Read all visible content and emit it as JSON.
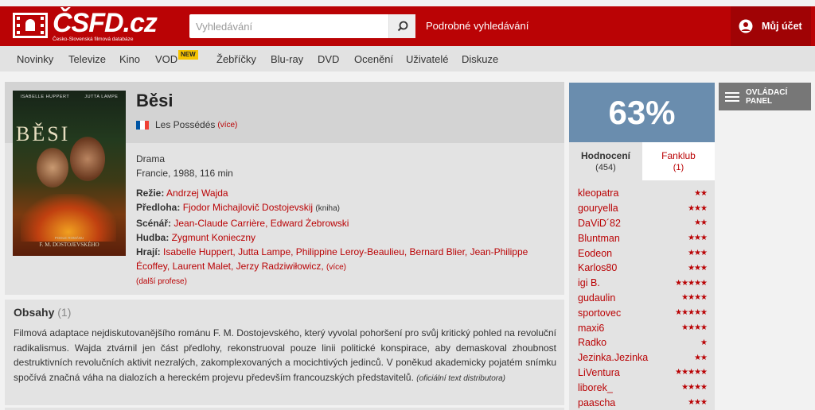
{
  "header": {
    "logo_text": "ČSFD.cz",
    "logo_subtitle": "Česko-Slovenská filmová databáze",
    "search_placeholder": "Vyhledávání",
    "advanced_search": "Podrobné vyhledávání",
    "account_label": "Můj účet"
  },
  "nav": {
    "items": [
      "Novinky",
      "Televize",
      "Kino",
      "VOD",
      "Žebříčky",
      "Blu-ray",
      "DVD",
      "Ocenění",
      "Uživatelé",
      "Diskuze"
    ],
    "new_badge": "NEW"
  },
  "film": {
    "poster": {
      "actor1": "ISABELLE HUPPERT",
      "actor2": "JUTTA LAMPE",
      "title": "BĚSI",
      "credit1": "PODLE ROMÁNU",
      "credit2": "F. M. DOSTOJEVSKÉHO"
    },
    "title": "Běsi",
    "alt_title": "Les Possédés",
    "more": "(více)",
    "genre": "Drama",
    "origin": "Francie, 1988, 116 min",
    "director_label": "Režie:",
    "director": "Andrzej Wajda",
    "source_label": "Předloha:",
    "source": "Fjodor Michajlovič Dostojevskij",
    "source_type": "(kniha)",
    "screenplay_label": "Scénář:",
    "screenplay": "Jean-Claude Carrière, Edward Żebrowski",
    "music_label": "Hudba:",
    "music": "Zygmunt Konieczny",
    "cast_label": "Hrají:",
    "cast": "Isabelle Huppert, Jutta Lampe, Philippine Leroy-Beaulieu, Bernard Blier, Jean-Philippe Écoffey, Laurent Malet, Jerzy Radziwiłowicz,",
    "cast_more": "(více)",
    "more_professions": "(další profese)"
  },
  "plot": {
    "title": "Obsahy",
    "count": "(1)",
    "text": "Filmová adaptace nejdiskutovanějšího románu F. M. Dostojevského, který vyvolal pohoršení pro svůj kritický pohled na revoluční radikalismus. Wajda ztvárnil jen část předlohy, rekonstruoval pouze linii politické konspirace, aby demaskoval zhoubnost destruktivních revolučních aktivit nezralých, zakomplexovaných a mocichtivých jedinců. V poněkud akademicky pojatém snímku spočívá značná váha na dialozích a hereckém projevu především francouzských představitelů.",
    "source": "(oficiální text distributora)"
  },
  "rating": {
    "percent": "63%",
    "tab_ratings": "Hodnocení",
    "tab_ratings_count": "(454)",
    "tab_fanclub": "Fanklub",
    "tab_fanclub_count": "(1)",
    "users": [
      {
        "name": "kleopatra",
        "stars": "★★"
      },
      {
        "name": "gouryella",
        "stars": "★★★"
      },
      {
        "name": "DaViD´82",
        "stars": "★★"
      },
      {
        "name": "Bluntman",
        "stars": "★★★"
      },
      {
        "name": "Eodeon",
        "stars": "★★★"
      },
      {
        "name": "Karlos80",
        "stars": "★★★"
      },
      {
        "name": "igi B.",
        "stars": "★★★★★"
      },
      {
        "name": "gudaulin",
        "stars": "★★★★"
      },
      {
        "name": "sportovec",
        "stars": "★★★★★"
      },
      {
        "name": "maxi6",
        "stars": "★★★★"
      },
      {
        "name": "Radko",
        "stars": "★"
      },
      {
        "name": "Jezinka.Jezinka",
        "stars": "★★"
      },
      {
        "name": "LiVentura",
        "stars": "★★★★★"
      },
      {
        "name": "liborek_",
        "stars": "★★★★"
      },
      {
        "name": "paascha",
        "stars": "★★★"
      }
    ]
  },
  "control_panel": {
    "label": "OVLÁDACÍ PANEL"
  }
}
